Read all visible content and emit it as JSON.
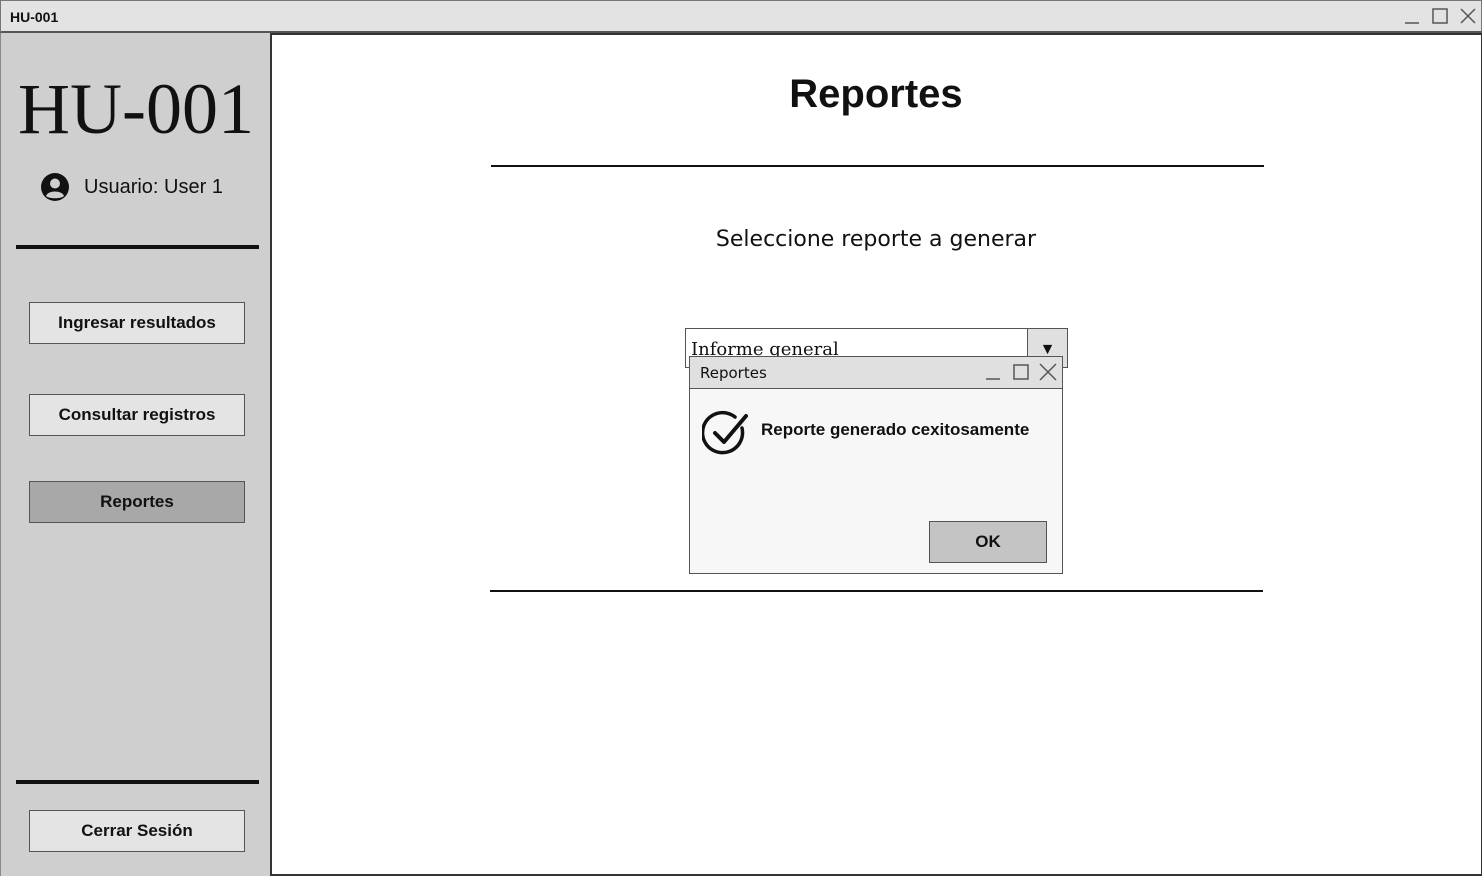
{
  "window": {
    "title": "HU-001",
    "controls": [
      "minimize-icon",
      "maximize-icon",
      "close-icon"
    ]
  },
  "sidebar": {
    "logo": "HU-001",
    "user_icon": "user-circle-icon",
    "user_label": "Usuario: User 1",
    "nav": [
      {
        "label": "Ingresar resultados",
        "active": false
      },
      {
        "label": "Consultar registros",
        "active": false
      },
      {
        "label": "Reportes",
        "active": true
      }
    ],
    "logout_label": "Cerrar Sesión"
  },
  "main": {
    "title": "Reportes",
    "select_label": "Seleccione reporte a generar",
    "select_value": "Informe general",
    "select_arrow": "▼"
  },
  "dialog": {
    "title": "Reportes",
    "icon": "check-circle-icon",
    "message": "Reporte generado cexitosamente",
    "ok_label": "OK"
  },
  "colors": {
    "sidebar_bg": "#cfcfcf",
    "active_nav_bg": "#a8a8a8",
    "titlebar_bg": "#e3e3e3"
  }
}
